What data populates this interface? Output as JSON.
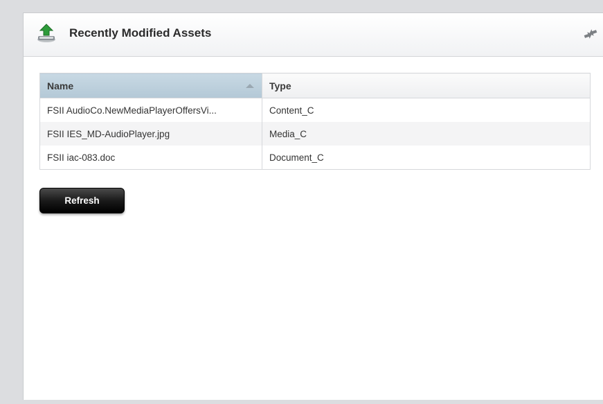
{
  "panel": {
    "title": "Recently Modified Assets",
    "icons": {
      "header": "upload-tray-icon",
      "swap": "swap-arrows-icon"
    }
  },
  "table": {
    "columns": [
      "Name",
      "Type"
    ],
    "rows": [
      {
        "name": "FSII AudioCo.NewMediaPlayerOffersVi...",
        "type": "Content_C"
      },
      {
        "name": "FSII IES_MD-AudioPlayer.jpg",
        "type": "Media_C"
      },
      {
        "name": "FSII iac-083.doc",
        "type": "Document_C"
      }
    ],
    "sort": {
      "column": "Name",
      "direction": "ascending"
    }
  },
  "buttons": {
    "refresh": "Refresh"
  },
  "colors": {
    "header_sorted_column": "#b9cddb",
    "button_bg": "#111111",
    "icon_green": "#2e9b3a"
  }
}
